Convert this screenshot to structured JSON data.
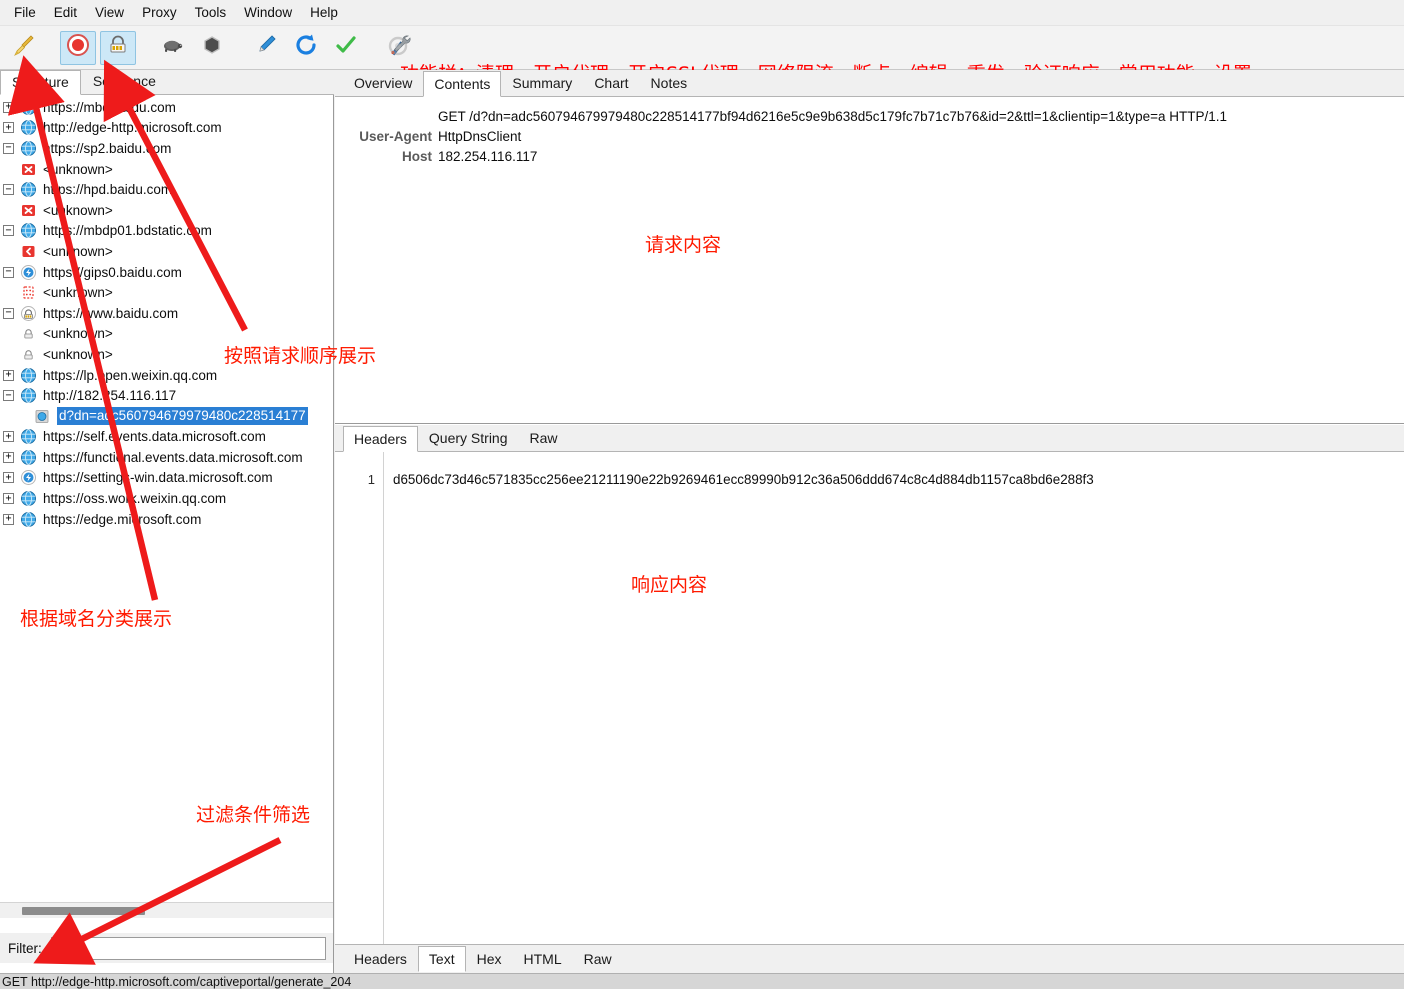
{
  "window": {
    "menubar": [
      {
        "label": "File"
      },
      {
        "label": "Edit"
      },
      {
        "label": "View"
      },
      {
        "label": "Proxy"
      },
      {
        "label": "Tools"
      },
      {
        "label": "Window"
      },
      {
        "label": "Help"
      }
    ]
  },
  "toolbar": {
    "annotation": "功能栏：清理、开启代理、开启SSL代理、网络限流、断点、编辑、重发、验证响应、常用功能、设置",
    "annotation_color": "#ff0000",
    "buttons": [
      {
        "name": "clear-broom-icon",
        "title": "清理",
        "toggled": false
      },
      {
        "name": "record-icon",
        "title": "开启代理",
        "toggled": true
      },
      {
        "name": "ssl-proxy-icon",
        "title": "开启SSL代理",
        "toggled": true
      },
      {
        "name": "throttle-turtle-icon",
        "title": "网络限流",
        "toggled": false
      },
      {
        "name": "breakpoint-icon",
        "title": "断点",
        "toggled": false
      },
      {
        "name": "compose-edit-icon",
        "title": "编辑",
        "toggled": false
      },
      {
        "name": "repeat-icon",
        "title": "重发",
        "toggled": false
      },
      {
        "name": "validate-check-icon",
        "title": "验证响应",
        "toggled": false
      },
      {
        "name": "tools-icon",
        "title": "常用功能",
        "toggled": false
      }
    ]
  },
  "left_panel": {
    "tabs": [
      {
        "label": "Structure",
        "active": true
      },
      {
        "label": "Sequence",
        "active": false
      }
    ],
    "tree": [
      {
        "label": "https://mbd.baidu.com",
        "icon": "globe-icon",
        "expander": "+",
        "depth": 0,
        "selected": false
      },
      {
        "label": "http://edge-http.microsoft.com",
        "icon": "globe-icon",
        "expander": "+",
        "depth": 0,
        "selected": false
      },
      {
        "label": "https://sp2.baidu.com",
        "icon": "globe-icon",
        "expander": "-",
        "depth": 0,
        "selected": false
      },
      {
        "label": "<unknown>",
        "icon": "error-x-icon",
        "expander": "",
        "depth": 1,
        "selected": false
      },
      {
        "label": "https://hpd.baidu.com",
        "icon": "globe-icon",
        "expander": "-",
        "depth": 0,
        "selected": false
      },
      {
        "label": "<unknown>",
        "icon": "error-x-icon",
        "expander": "",
        "depth": 1,
        "selected": false
      },
      {
        "label": "https://mbdp01.bdstatic.com",
        "icon": "globe-icon",
        "expander": "-",
        "depth": 0,
        "selected": false
      },
      {
        "label": "<unknown>",
        "icon": "warning-arrow-icon",
        "expander": "",
        "depth": 1,
        "selected": false
      },
      {
        "label": "https://gips0.baidu.com",
        "icon": "bolt-icon",
        "expander": "-",
        "depth": 0,
        "selected": false
      },
      {
        "label": "<unknown>",
        "icon": "dotted-red-icon",
        "expander": "",
        "depth": 1,
        "selected": false
      },
      {
        "label": "https://www.baidu.com",
        "icon": "lock-icon",
        "expander": "-",
        "depth": 0,
        "selected": false
      },
      {
        "label": "<unknown>",
        "icon": "lock-small-icon",
        "expander": "",
        "depth": 1,
        "selected": false
      },
      {
        "label": "<unknown>",
        "icon": "lock-small-icon",
        "expander": "",
        "depth": 1,
        "selected": false
      },
      {
        "label": "https://lp.open.weixin.qq.com",
        "icon": "globe-icon",
        "expander": "+",
        "depth": 0,
        "selected": false
      },
      {
        "label": "http://182.254.116.117",
        "icon": "globe-icon",
        "expander": "-",
        "depth": 0,
        "selected": false
      },
      {
        "label": "d?dn=adc560794679979480c228514177",
        "icon": "page-icon",
        "expander": "",
        "depth": 1,
        "selected": true
      },
      {
        "label": "https://self.events.data.microsoft.com",
        "icon": "globe-icon",
        "expander": "+",
        "depth": 0,
        "selected": false
      },
      {
        "label": "https://functional.events.data.microsoft.com",
        "icon": "globe-icon",
        "expander": "+",
        "depth": 0,
        "selected": false
      },
      {
        "label": "https://settings-win.data.microsoft.com",
        "icon": "bolt-icon",
        "expander": "+",
        "depth": 0,
        "selected": false
      },
      {
        "label": "https://oss.work.weixin.qq.com",
        "icon": "globe-icon",
        "expander": "+",
        "depth": 0,
        "selected": false
      },
      {
        "label": "https://edge.microsoft.com",
        "icon": "globe-icon",
        "expander": "+",
        "depth": 0,
        "selected": false
      }
    ],
    "filter": {
      "label": "Filter:",
      "value": "",
      "placeholder": ""
    }
  },
  "right_panel": {
    "tabs": [
      {
        "label": "Overview",
        "active": false
      },
      {
        "label": "Contents",
        "active": true
      },
      {
        "label": "Summary",
        "active": false
      },
      {
        "label": "Chart",
        "active": false
      },
      {
        "label": "Notes",
        "active": false
      }
    ],
    "request": {
      "headers": [
        {
          "key": "",
          "value": "GET /d?dn=adc560794679979480c228514177bf94d6216e5c9e9b638d5c179fc7b71c7b76&id=2&ttl=1&clientip=1&type=a HTTP/1.1"
        },
        {
          "key": "User-Agent",
          "value": "HttpDnsClient"
        },
        {
          "key": "Host",
          "value": "182.254.116.117"
        }
      ],
      "annotation": "请求内容"
    },
    "response_tabs": [
      {
        "label": "Headers",
        "active": true
      },
      {
        "label": "Query String",
        "active": false
      },
      {
        "label": "Raw",
        "active": false
      }
    ],
    "body": {
      "line_number": "1",
      "text": "d6506dc73d46c571835cc256ee21211190e22b9269461ecc89990b912c36a506ddd674c8c4d884db1157ca8bd6e288f3",
      "annotation": "响应内容"
    },
    "bottom_tabs": [
      {
        "label": "Headers",
        "active": false
      },
      {
        "label": "Text",
        "active": true
      },
      {
        "label": "Hex",
        "active": false
      },
      {
        "label": "HTML",
        "active": false
      },
      {
        "label": "Raw",
        "active": false
      }
    ]
  },
  "annotations": [
    {
      "name": "structure-annotation",
      "text": "根据域名分类展示",
      "color": "#ff1a00"
    },
    {
      "name": "sequence-annotation",
      "text": "按照请求顺序展示",
      "color": "#ff1a00"
    },
    {
      "name": "filter-annotation",
      "text": "过滤条件筛选",
      "color": "#ff1a00"
    }
  ],
  "statusbar": {
    "text": "GET http://edge-http.microsoft.com/captiveportal/generate_204"
  }
}
